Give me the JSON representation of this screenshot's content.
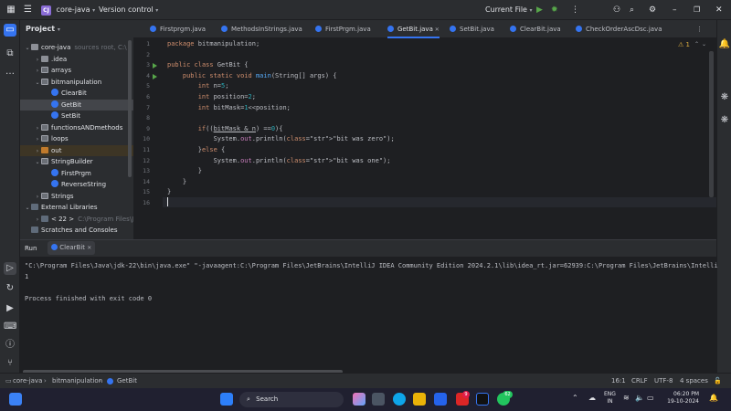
{
  "titlebar": {
    "project_badge": "CJ",
    "project_name": "core-java",
    "vcs": "Version control",
    "run_config": "Current File",
    "icons": [
      "run-icon",
      "debug-icon",
      "more-icon",
      "add-user-icon",
      "search-icon",
      "settings-icon",
      "minimize-icon",
      "restore-icon",
      "close-icon"
    ]
  },
  "project_panel": {
    "title": "Project",
    "tree": [
      {
        "label": "core-java",
        "suffix": "sources root,  C:\\",
        "depth": 0,
        "type": "folder",
        "open": true
      },
      {
        "label": ".idea",
        "depth": 1,
        "type": "folder",
        "open": false
      },
      {
        "label": "arrays",
        "depth": 1,
        "type": "pkg",
        "open": false
      },
      {
        "label": "bitmanipulation",
        "depth": 1,
        "type": "pkg",
        "open": true
      },
      {
        "label": "ClearBit",
        "depth": 2,
        "type": "class"
      },
      {
        "label": "GetBit",
        "depth": 2,
        "type": "class",
        "selected": true
      },
      {
        "label": "SetBit",
        "depth": 2,
        "type": "class"
      },
      {
        "label": "functionsANDmethods",
        "depth": 1,
        "type": "pkg",
        "open": false
      },
      {
        "label": "loops",
        "depth": 1,
        "type": "pkg",
        "open": false
      },
      {
        "label": "out",
        "depth": 1,
        "type": "out",
        "open": false,
        "highlight": true
      },
      {
        "label": "StringBuilder",
        "depth": 1,
        "type": "pkg",
        "open": true
      },
      {
        "label": "FirstPrgm",
        "depth": 2,
        "type": "class"
      },
      {
        "label": "ReverseString",
        "depth": 2,
        "type": "class"
      },
      {
        "label": "Strings",
        "depth": 1,
        "type": "pkg",
        "open": false
      },
      {
        "label": "External Libraries",
        "depth": 0,
        "type": "lib",
        "open": true
      },
      {
        "label": "< 22 >",
        "suffix": "C:\\Program Files\\Ja",
        "depth": 1,
        "type": "lib",
        "open": false
      },
      {
        "label": "Scratches and Consoles",
        "depth": 0,
        "type": "lib"
      }
    ]
  },
  "tabs": [
    {
      "label": "Firstprgm.java"
    },
    {
      "label": "MethodsInStrings.java"
    },
    {
      "label": "FirstPrgm.java"
    },
    {
      "label": "GetBit.java",
      "active": true
    },
    {
      "label": "SetBit.java"
    },
    {
      "label": "ClearBit.java"
    },
    {
      "label": "CheckOrderAscDsc.java"
    }
  ],
  "editor": {
    "warnings": "1",
    "line_numbers": [
      "1",
      "2",
      "3",
      "4",
      "5",
      "6",
      "7",
      "8",
      "9",
      "10",
      "11",
      "12",
      "13",
      "14",
      "15",
      "16"
    ],
    "lines": [
      "package bitmanipulation;",
      "",
      "public class GetBit {",
      "    public static void main(String[] args) {",
      "        int n=5;",
      "        int position=2;",
      "        int bitMask=1<<position;",
      "",
      "        if((bitMask & n) ==0){",
      "            System.out.println(\"bit was zero\");",
      "        }else {",
      "            System.out.println(\"bit was one\");",
      "        }",
      "    }",
      "}",
      ""
    ]
  },
  "run_panel": {
    "tab_run": "Run",
    "tab_config": "ClearBit",
    "output": [
      "\"C:\\Program Files\\Java\\jdk-22\\bin\\java.exe\" \"-javaagent:C:\\Program Files\\JetBrains\\IntelliJ IDEA Community Edition 2024.2.1\\lib\\idea_rt.jar=62939:C:\\Program Files\\JetBrains\\Intelli",
      "1",
      "",
      "Process finished with exit code 0"
    ]
  },
  "statusbar": {
    "crumbs": [
      "core-java",
      "bitmanipulation",
      "GetBit"
    ],
    "position": "16:1",
    "line_sep": "CRLF",
    "encoding": "UTF-8",
    "indent": "4 spaces"
  },
  "taskbar": {
    "search": "Search",
    "lang": "ENG",
    "region": "IN",
    "time": "06:20 PM",
    "date": "19-10-2024",
    "badges": {
      "app1": "9",
      "whatsapp": "62"
    }
  },
  "colors": {
    "accent": "#3574f0",
    "run_green": "#57a64a",
    "keyword": "#cf8e6d",
    "string": "#6aab73",
    "number": "#2aacb8",
    "field": "#c77dbb",
    "method": "#56a8f5"
  }
}
